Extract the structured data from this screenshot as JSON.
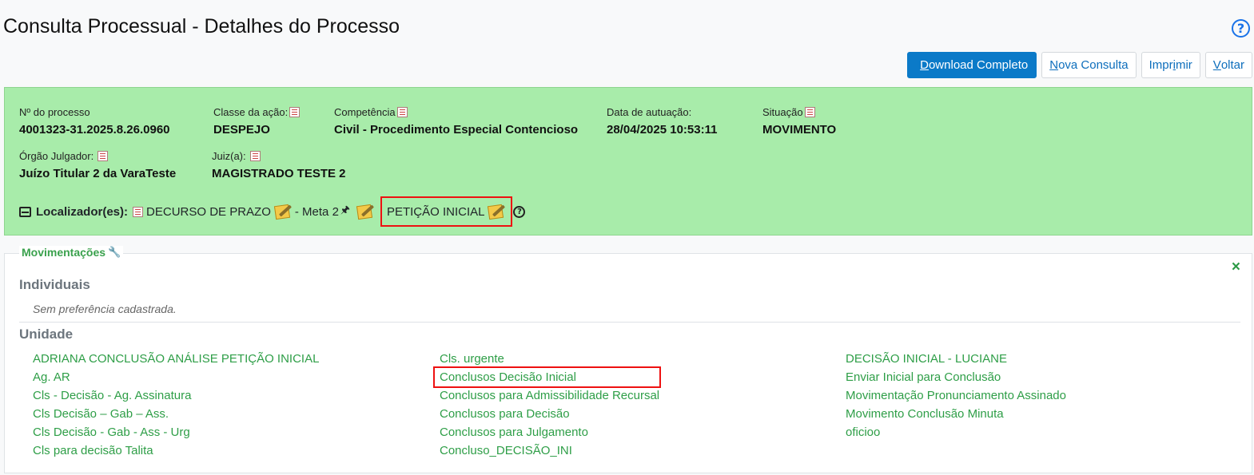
{
  "header": {
    "title": "Consulta Processual - Detalhes do Processo",
    "help_glyph": "?"
  },
  "toolbar": {
    "download": {
      "first": "D",
      "rest": "ownload Completo"
    },
    "nova": {
      "first": "N",
      "rest": "ova Consulta"
    },
    "imprimir": {
      "pre": "Impr",
      "ul": "i",
      "post": "mir"
    },
    "voltar": {
      "first": "V",
      "rest": "oltar"
    }
  },
  "process": {
    "numero": {
      "label": "Nº do processo",
      "value": "4001323-31.2025.8.26.0960"
    },
    "classe": {
      "label": "Classe da ação:",
      "value": "DESPEJO"
    },
    "competencia": {
      "label": "Competência",
      "value": "Civil - Procedimento Especial Contencioso"
    },
    "data": {
      "label": "Data de autuação:",
      "value": "28/04/2025 10:53:11"
    },
    "situacao": {
      "label": "Situação",
      "value": "MOVIMENTO"
    },
    "orgao": {
      "label": "Órgão Julgador:",
      "value": "Juízo Titular 2 da VaraTeste"
    },
    "juiz": {
      "label": "Juiz(a):",
      "value": "MAGISTRADO TESTE 2"
    },
    "localizador": {
      "label": "Localizador(es):",
      "item1": "DECURSO DE PRAZO",
      "item2": "- Meta 2",
      "pin_glyph": "🖈",
      "item3": "PETIÇÃO INICIAL",
      "help_glyph": "?"
    }
  },
  "movimentacoes": {
    "legend": "Movimentações",
    "wrench_glyph": "🔧",
    "close_glyph": "×",
    "individuais_title": "Individuais",
    "individuais_empty": "Sem preferência cadastrada.",
    "unidade_title": "Unidade",
    "col1": [
      "ADRIANA CONCLUSÃO ANÁLISE PETIÇÃO INICIAL",
      "Ag. AR",
      "Cls - Decisão - Ag. Assinatura",
      "Cls Decisão – Gab – Ass.",
      "Cls Decisão - Gab - Ass - Urg",
      "Cls para decisão Talita"
    ],
    "col2": [
      "Cls. urgente",
      "Conclusos Decisão Inicial",
      "Conclusos para Admissibilidade Recursal",
      "Conclusos para Decisão",
      "Conclusos para Julgamento",
      "Concluso_DECISÃO_INI"
    ],
    "col3": [
      "DECISÃO INICIAL - LUCIANE",
      "Enviar Inicial para Conclusão",
      "Movimentação Pronunciamento Assinado",
      "Movimento Conclusão Minuta",
      "oficioo"
    ]
  }
}
